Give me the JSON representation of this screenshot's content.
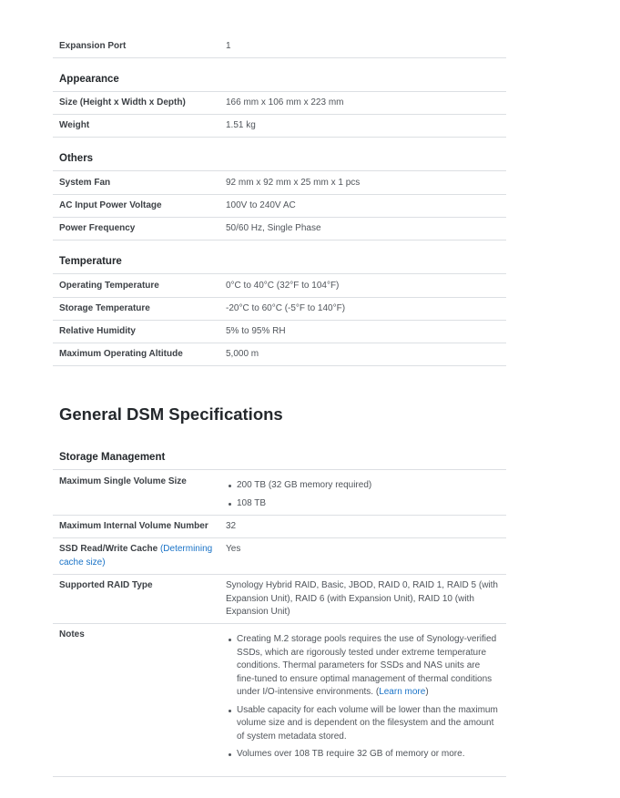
{
  "hardware": {
    "expansion_port": {
      "label": "Expansion Port",
      "value": "1"
    },
    "appearance": {
      "heading": "Appearance",
      "size": {
        "label": "Size (Height x Width x Depth)",
        "value": "166 mm x 106 mm x 223 mm"
      },
      "weight": {
        "label": "Weight",
        "value": "1.51 kg"
      }
    },
    "others": {
      "heading": "Others",
      "fan": {
        "label": "System Fan",
        "value": "92 mm x 92 mm x 25 mm x 1 pcs"
      },
      "voltage": {
        "label": "AC Input Power Voltage",
        "value": "100V to 240V AC"
      },
      "frequency": {
        "label": "Power Frequency",
        "value": "50/60 Hz, Single Phase"
      }
    },
    "temperature": {
      "heading": "Temperature",
      "operating": {
        "label": "Operating Temperature",
        "value": "0°C to 40°C (32°F to 104°F)"
      },
      "storage": {
        "label": "Storage Temperature",
        "value": "-20°C to 60°C (-5°F to 140°F)"
      },
      "humidity": {
        "label": "Relative Humidity",
        "value": "5% to 95% RH"
      },
      "altitude": {
        "label": "Maximum Operating Altitude",
        "value": "5,000 m"
      }
    }
  },
  "dsm": {
    "title": "General DSM Specifications",
    "storage_heading": "Storage Management",
    "max_volume": {
      "label": "Maximum Single Volume Size",
      "items": [
        "200 TB (32 GB memory required)",
        "108 TB"
      ]
    },
    "internal_volumes": {
      "label": "Maximum Internal Volume Number",
      "value": "32"
    },
    "ssd_cache": {
      "label": "SSD Read/Write Cache",
      "link": "(Determining cache size)",
      "value": "Yes"
    },
    "raid": {
      "label": "Supported RAID Type",
      "value": "Synology Hybrid RAID, Basic, JBOD, RAID 0, RAID 1, RAID 5 (with Expansion Unit), RAID 6 (with Expansion Unit), RAID 10 (with Expansion Unit)"
    },
    "notes": {
      "label": "Notes",
      "note1": "Creating M.2 storage pools requires the use of Synology-verified SSDs, which are rigorously tested under extreme temperature conditions. Thermal parameters for SSDs and NAS units are fine-tuned to ensure optimal management of thermal conditions under I/O-intensive environments. (",
      "note1_link": "Learn more",
      "note1_end": ")",
      "note2": "Usable capacity for each volume will be lower than the maximum volume size and is dependent on the filesystem and the amount of system metadata stored.",
      "note3": "Volumes over 108 TB require 32 GB of memory or more."
    }
  }
}
